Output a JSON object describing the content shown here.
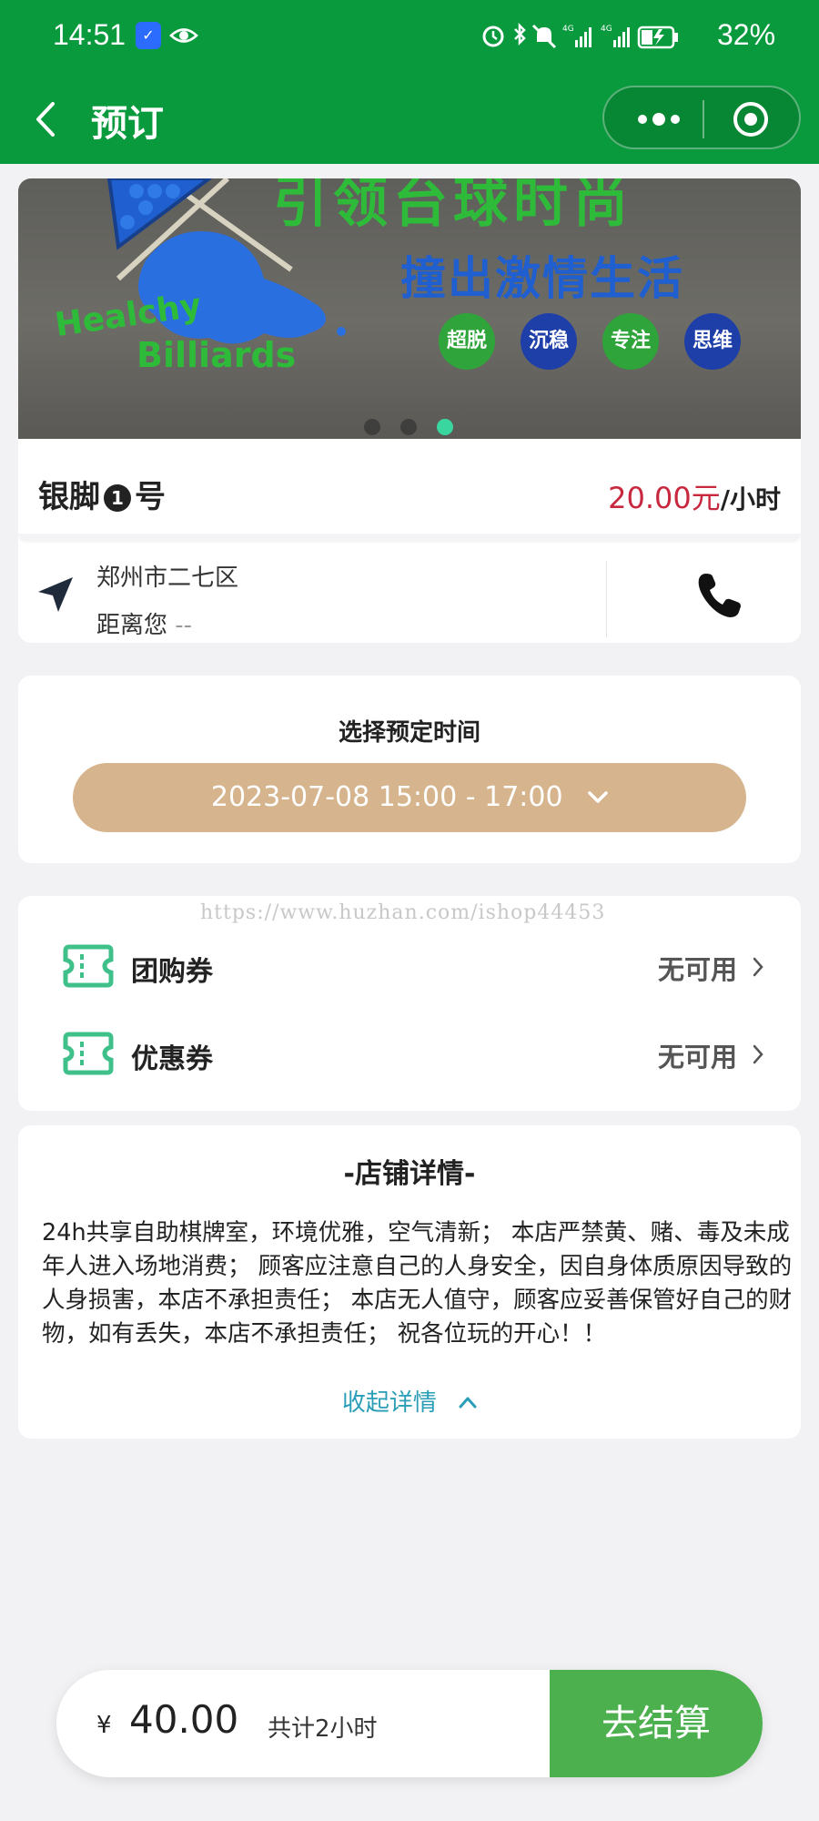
{
  "status_bar": {
    "time": "14:51",
    "battery": "32%"
  },
  "nav": {
    "title": "预订"
  },
  "store": {
    "banner": {
      "line1": "引领台球时尚",
      "line2": "撞出激情生活",
      "brand_line1": "Healchy",
      "brand_line2": "Billiards",
      "badges": [
        "超脱",
        "沉稳",
        "专注",
        "思维"
      ]
    },
    "slide_count": 3,
    "active_slide": 3,
    "name_prefix": "银脚",
    "name_number": "1",
    "name_suffix": "号",
    "price": "20.00元",
    "price_unit": "/小时",
    "city": "郑州市二七区",
    "distance_label": "距离您",
    "distance_value": "--"
  },
  "booking": {
    "title": "选择预定时间",
    "selected_time": "2023-07-08 15:00 - 17:00"
  },
  "coupons": {
    "watermark": "https://www.huzhan.com/ishop44453",
    "items": [
      {
        "label": "团购券",
        "value": "无可用"
      },
      {
        "label": "优惠券",
        "value": "无可用"
      }
    ]
  },
  "details": {
    "title": "-店铺详情-",
    "text": "24h共享自助棋牌室，环境优雅，空气清新； 本店严禁黄、赌、毒及未成年人进入场地消费； 顾客应注意自己的人身安全，因自身体质原因导致的人身损害，本店不承担责任； 本店无人值守，顾客应妥善保管好自己的财物，如有丢失，本店不承担责任； 祝各位玩的开心！！",
    "collapse_label": "收起详情"
  },
  "footer": {
    "currency": "¥",
    "amount": "40.00",
    "total_hours": "共计2小时",
    "checkout_label": "去结算"
  },
  "colors": {
    "brand_green": "#089a3c",
    "price_red": "#c8283e",
    "time_pill": "#d6b58e",
    "checkout_green": "#4cb04f",
    "link_teal": "#2a9db7",
    "coupon_icon": "#3fc08a"
  },
  "icons": {
    "back": "chevron-left-icon",
    "more": "more-dots-icon",
    "close": "target-circle-icon",
    "location": "navigation-arrow-icon",
    "phone": "phone-icon",
    "coupon": "ticket-icon",
    "arrow": "chevron-right-icon"
  }
}
